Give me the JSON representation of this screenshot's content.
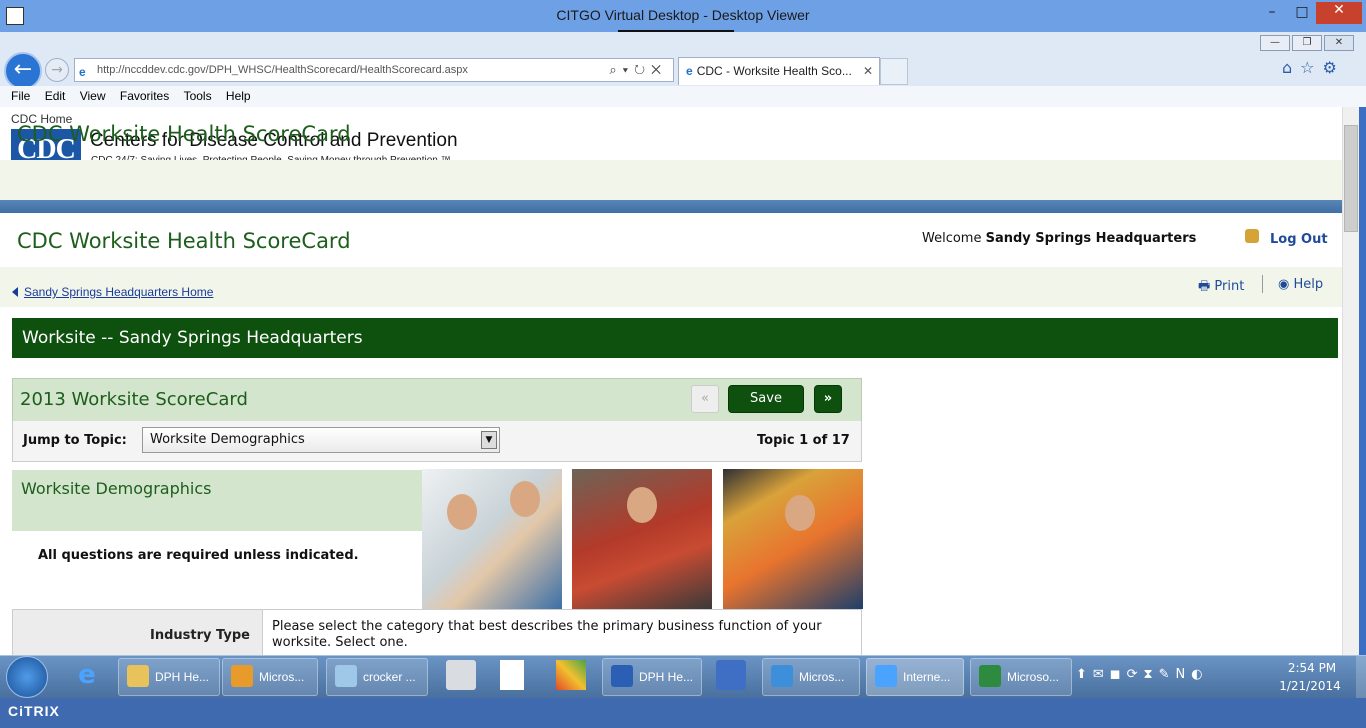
{
  "outer_window": {
    "title": "CITGO Virtual Desktop - Desktop Viewer",
    "min": "–",
    "max": "□",
    "close": "✕"
  },
  "citrix_bar": {
    "label": "⠿⠿⠿ ⬇ ⠿⠿⠿"
  },
  "browser": {
    "window_buttons": {
      "min": "—",
      "max": "❐",
      "close": "✕"
    },
    "url_prefix": "http://ncc",
    "url": "http://nccddev.cdc.gov/DPH_WHSC/HealthScorecard/HealthScorecard.aspx",
    "url_tools": "⌕▾↻✕",
    "tab_title": "CDC - Worksite Health Sco...",
    "tab_close": "✕",
    "right_icons": "⌂☆⚙",
    "menu": [
      "File",
      "Edit",
      "View",
      "Favorites",
      "Tools",
      "Help"
    ]
  },
  "cdc_header": {
    "home_link": "CDC Home",
    "logo_text": "CDC",
    "org_name": "Centers for Disease Control and Prevention",
    "tagline": "CDC 24/7: Saving Lives. Protecting People. Saving Money through Prevention.™"
  },
  "app": {
    "title": "CDC Worksite Health ScoreCard",
    "welcome_prefix": "Welcome ",
    "welcome_user": "Sandy Springs Headquarters",
    "logout": "Log Out",
    "breadcrumb": "Sandy Springs Headquarters Home",
    "print": "Print",
    "help": "Help",
    "worksite_bar": "Worksite -- Sandy Springs Headquarters"
  },
  "scorecard": {
    "title": "2013 Worksite ScoreCard",
    "prev": "«",
    "save": "Save",
    "next": "»",
    "jump_label": "Jump to Topic:",
    "jump_value": "Worksite Demographics",
    "jump_arrow": "▼",
    "topic_count": "Topic 1 of 17",
    "section_title": "Worksite Demographics",
    "required_note": "All questions are required unless indicated.",
    "industry_label": "Industry Type",
    "industry_question": "Please select the category that best describes the primary business function of your worksite. Select one."
  },
  "taskbar": {
    "items": [
      {
        "label": "DPH He..."
      },
      {
        "label": "Micros..."
      },
      {
        "label": "crocker ..."
      },
      {
        "label": "DPH He..."
      },
      {
        "label": "Micros..."
      },
      {
        "label": "Interne..."
      },
      {
        "label": "Microso..."
      }
    ],
    "tray": "⬆✉◼⟳⧗✎N◐",
    "time": "2:54 PM",
    "date": "1/21/2014"
  },
  "citrix_footer": {
    "logo": "CiTRIX"
  },
  "colors": {
    "accent_green": "#0e500e",
    "header_green": "#d3e5cc",
    "link_blue": "#1f4a9a"
  }
}
